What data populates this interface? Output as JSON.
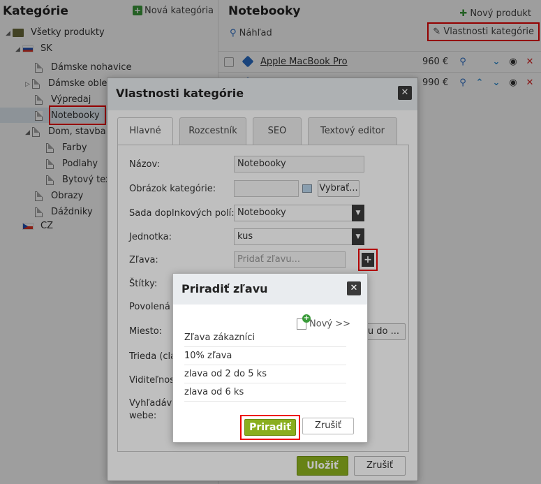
{
  "left_panel": {
    "title": "Kategórie",
    "new_category": "Nová kategória",
    "tree": {
      "all_products": "Všetky produkty",
      "sk": "SK",
      "items": [
        "Dámske nohavice",
        "Dámske oble",
        "Výpredaj",
        "Notebooky",
        "Dom, stavba"
      ],
      "sub_items": [
        "Farby",
        "Podlahy",
        "Bytový tex"
      ],
      "more_items": [
        "Obrazy",
        "Dáždniky"
      ],
      "cz": "CZ"
    }
  },
  "right_panel": {
    "title": "Notebooky",
    "new_product": "Nový produkt",
    "preview": "Náhľad",
    "category_properties": "Vlastnosti kategórie",
    "products": [
      {
        "name": "Apple MacBook Pro",
        "price": "960 €"
      },
      {
        "name": "",
        "price": "990 €"
      }
    ]
  },
  "main_dialog": {
    "title": "Vlastnosti kategórie",
    "close": "✕",
    "tabs": [
      "Hlavné",
      "Rozcestník",
      "SEO",
      "Textový editor"
    ],
    "fields": {
      "name_label": "Názov:",
      "name_value": "Notebooky",
      "image_label": "Obrázok kategórie:",
      "choose_button": "Vybrať...",
      "field_set_label": "Sada doplnkových polí:",
      "field_set_value": "Notebooky",
      "unit_label": "Jednotka:",
      "unit_value": "kus",
      "discount_label": "Zľava:",
      "discount_placeholder": "Pridať zľavu...",
      "tags_label": "Štítky:",
      "allowed_label": "Povolená c",
      "place_label": "Miesto:",
      "place_button": "riu do ...",
      "class_label": "Trieda (clas",
      "visibility_label": "Viditeľnosť",
      "search_label_1": "Vyhľadáva",
      "search_label_2": "webe:"
    },
    "save": "Uložiť",
    "cancel": "Zrušiť"
  },
  "discount_dialog": {
    "title": "Priradiť zľavu",
    "close": "✕",
    "new_link": "Nový >>",
    "items": [
      "Zľava zákazníci",
      "10% zľava",
      "zlava od 2 do 5 ks",
      "zlava od 6 ks"
    ],
    "assign": "Priradiť",
    "cancel": "Zrušiť"
  },
  "colors": {
    "accent_green": "#8aae1e",
    "highlight_red": "#ee0000",
    "link_blue": "#2a6fc9"
  }
}
